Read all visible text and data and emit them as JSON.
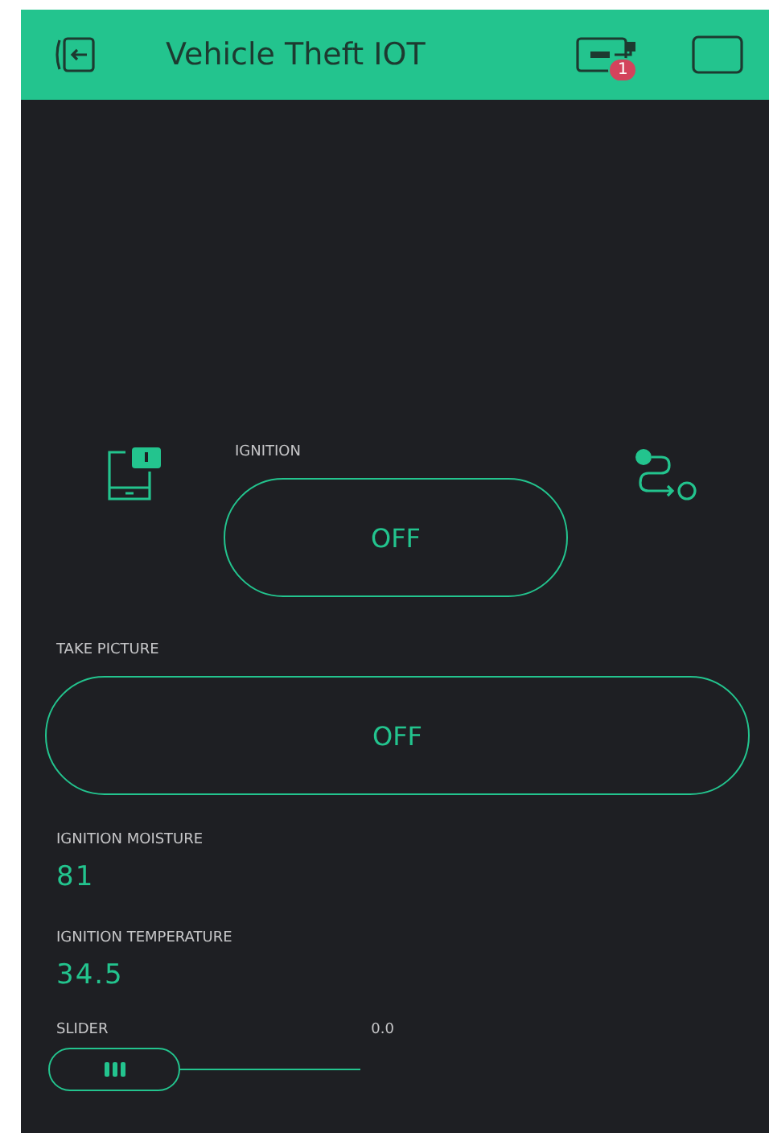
{
  "header": {
    "title": "Vehicle Theft IOT",
    "badge": "1"
  },
  "ignition": {
    "label": "IGNITION",
    "button": "OFF",
    "on": false
  },
  "take_picture": {
    "label": "TAKE PICTURE",
    "button": "OFF",
    "on": false
  },
  "displays": [
    {
      "label": "IGNITION MOISTURE",
      "value": "81"
    },
    {
      "label": "IGNITION TEMPERATURE",
      "value": "34.5"
    }
  ],
  "slider": {
    "label": "SLIDER",
    "reading": "0.0"
  }
}
